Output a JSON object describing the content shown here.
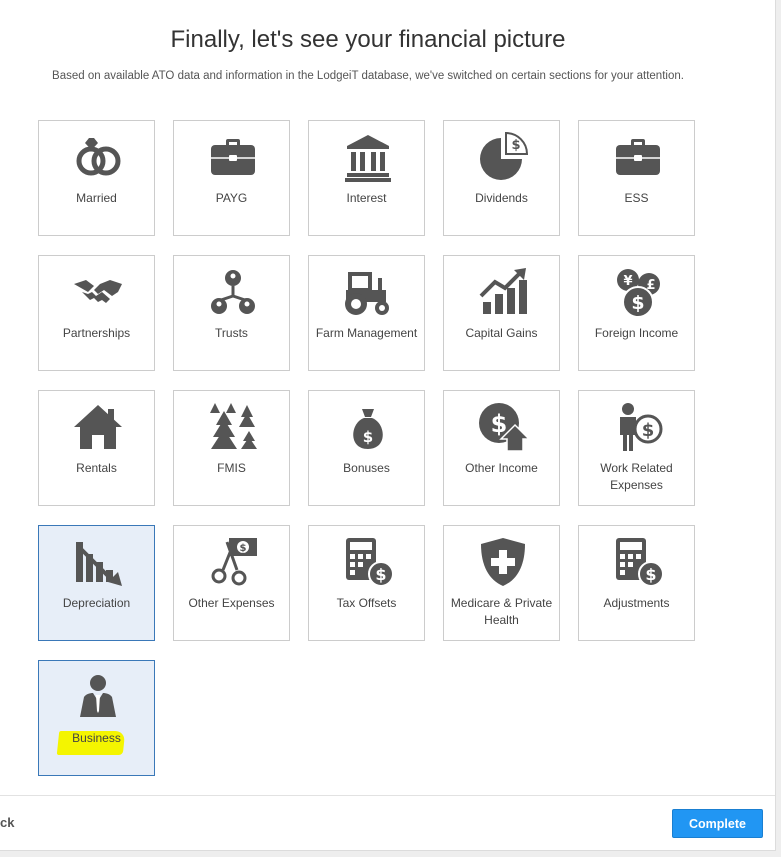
{
  "header": {
    "title": "Finally, let's see your financial picture",
    "subtitle": "Based on available ATO data and information in the LodgeiT database, we've switched on certain sections for your attention."
  },
  "tiles": [
    {
      "label": "Married",
      "icon": "married-rings-icon",
      "active": false
    },
    {
      "label": "PAYG",
      "icon": "briefcase-icon",
      "active": false
    },
    {
      "label": "Interest",
      "icon": "bank-icon",
      "active": false
    },
    {
      "label": "Dividends",
      "icon": "pie-chart-dollar-icon",
      "active": false
    },
    {
      "label": "ESS",
      "icon": "briefcase-icon",
      "active": false
    },
    {
      "label": "Partnerships",
      "icon": "handshake-icon",
      "active": false
    },
    {
      "label": "Trusts",
      "icon": "people-network-icon",
      "active": false
    },
    {
      "label": "Farm Management",
      "icon": "tractor-icon",
      "active": false
    },
    {
      "label": "Capital Gains",
      "icon": "growth-chart-icon",
      "active": false
    },
    {
      "label": "Foreign Income",
      "icon": "currency-coins-icon",
      "active": false
    },
    {
      "label": "Rentals",
      "icon": "house-icon",
      "active": false
    },
    {
      "label": "FMIS",
      "icon": "forest-trees-icon",
      "active": false
    },
    {
      "label": "Bonuses",
      "icon": "money-bag-icon",
      "active": false
    },
    {
      "label": "Other Income",
      "icon": "dollar-up-arrow-icon",
      "active": false
    },
    {
      "label": "Work Related Expenses",
      "icon": "worker-dollar-icon",
      "active": false
    },
    {
      "label": "Depreciation",
      "icon": "declining-chart-icon",
      "active": true
    },
    {
      "label": "Other Expenses",
      "icon": "scissors-cash-icon",
      "active": false
    },
    {
      "label": "Tax Offsets",
      "icon": "calculator-dollar-icon",
      "active": false
    },
    {
      "label": "Medicare & Private Health",
      "icon": "shield-cross-icon",
      "active": false
    },
    {
      "label": "Adjustments",
      "icon": "calculator-dollar-icon",
      "active": false
    },
    {
      "label": "Business",
      "icon": "businessman-icon",
      "active": true
    }
  ],
  "footer": {
    "back_label": "ck",
    "complete_label": "Complete"
  },
  "colors": {
    "icon": "#555555",
    "accent": "#2196f3",
    "active_bg": "#e7eef8",
    "active_border": "#3a78b8",
    "highlight": "#f4f500"
  }
}
